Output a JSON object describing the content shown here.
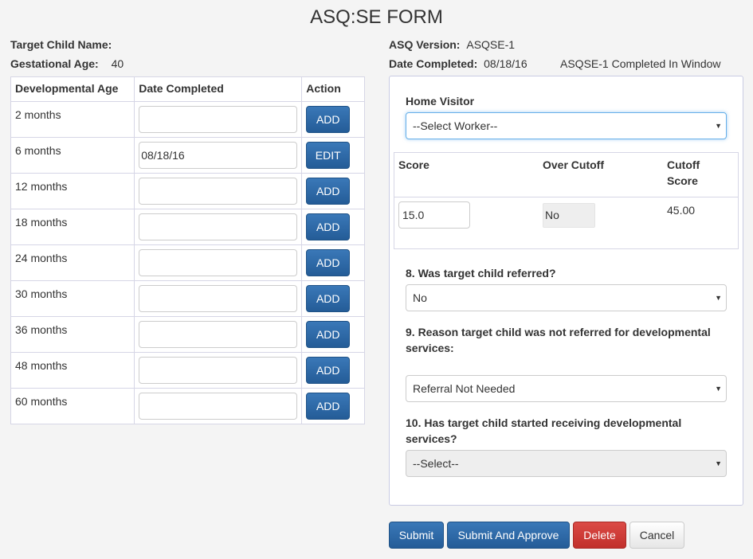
{
  "title": "ASQ:SE FORM",
  "info": {
    "target_child_label": "Target Child Name:",
    "target_child_value": "",
    "gestational_age_label": "Gestational Age:",
    "gestational_age_value": "40",
    "asq_version_label": "ASQ Version:",
    "asq_version_value": "ASQSE-1",
    "date_completed_label": "Date Completed:",
    "date_completed_value": "08/18/16",
    "window_status": "ASQSE-1 Completed In Window"
  },
  "table": {
    "headers": [
      "Developmental Age",
      "Date Completed",
      "Action"
    ],
    "rows": [
      {
        "age": "2 months",
        "date": "",
        "action": "ADD"
      },
      {
        "age": "6 months",
        "date": "08/18/16",
        "action": "EDIT"
      },
      {
        "age": "12 months",
        "date": "",
        "action": "ADD"
      },
      {
        "age": "18 months",
        "date": "",
        "action": "ADD"
      },
      {
        "age": "24 months",
        "date": "",
        "action": "ADD"
      },
      {
        "age": "30 months",
        "date": "",
        "action": "ADD"
      },
      {
        "age": "36 months",
        "date": "",
        "action": "ADD"
      },
      {
        "age": "48 months",
        "date": "",
        "action": "ADD"
      },
      {
        "age": "60 months",
        "date": "",
        "action": "ADD"
      }
    ]
  },
  "form": {
    "home_visitor_label": "Home Visitor",
    "home_visitor_value": "--Select Worker--",
    "score_header": "Score",
    "over_cutoff_header": "Over Cutoff",
    "cutoff_score_header_1": "Cutoff",
    "cutoff_score_header_2": "Score",
    "score_value": "15.0",
    "over_cutoff_value": "No",
    "cutoff_score_value": "45.00",
    "q8_label": "8. Was target child referred?",
    "q8_value": "No",
    "q9_label_1": "9. Reason target child was not referred for developmental",
    "q9_label_2": "services:",
    "q9_value": "Referral Not Needed",
    "q10_label_1": "10. Has target child started receiving developmental",
    "q10_label_2": "services?",
    "q10_value": "--Select--"
  },
  "buttons": {
    "submit": "Submit",
    "submit_approve": "Submit And Approve",
    "delete": "Delete",
    "cancel": "Cancel"
  },
  "icons": {
    "select_caret": "▼"
  },
  "colors": {
    "primary": "#2a64a0",
    "danger": "#c9302c",
    "focus": "#66afe9"
  }
}
